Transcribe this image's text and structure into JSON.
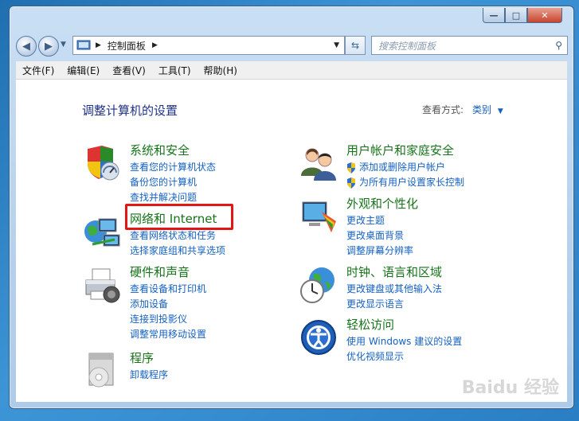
{
  "window": {
    "caption_buttons": {
      "minimize": "—",
      "maximize": "□",
      "close": "✕"
    }
  },
  "nav": {
    "back_icon": "back-arrow-icon",
    "forward_icon": "forward-arrow-icon",
    "address_path": "控制面板",
    "search_placeholder": "搜索控制面板"
  },
  "menubar": {
    "items": [
      "文件(F)",
      "编辑(E)",
      "查看(V)",
      "工具(T)",
      "帮助(H)"
    ]
  },
  "main": {
    "heading": "调整计算机的设置",
    "view_by_label": "查看方式:",
    "view_by_value": "类别"
  },
  "categories": [
    {
      "title": "系统和安全",
      "links": [
        "查看您的计算机状态",
        "备份您的计算机",
        "查找并解决问题"
      ]
    },
    {
      "title": "网络和 Internet",
      "links": [
        "查看网络状态和任务",
        "选择家庭组和共享选项"
      ]
    },
    {
      "title": "硬件和声音",
      "links": [
        "查看设备和打印机",
        "添加设备",
        "连接到投影仪",
        "调整常用移动设置"
      ]
    },
    {
      "title": "程序",
      "links": [
        "卸载程序"
      ]
    },
    {
      "title": "用户帐户和家庭安全",
      "links": [
        "添加或删除用户帐户",
        "为所有用户设置家长控制"
      ]
    },
    {
      "title": "外观和个性化",
      "links": [
        "更改主题",
        "更改桌面背景",
        "调整屏幕分辨率"
      ]
    },
    {
      "title": "时钟、语言和区域",
      "links": [
        "更改键盘或其他输入法",
        "更改显示语言"
      ]
    },
    {
      "title": "轻松访问",
      "links": [
        "使用 Windows 建议的设置",
        "优化视频显示"
      ]
    }
  ],
  "watermark": "Baidu 经验"
}
